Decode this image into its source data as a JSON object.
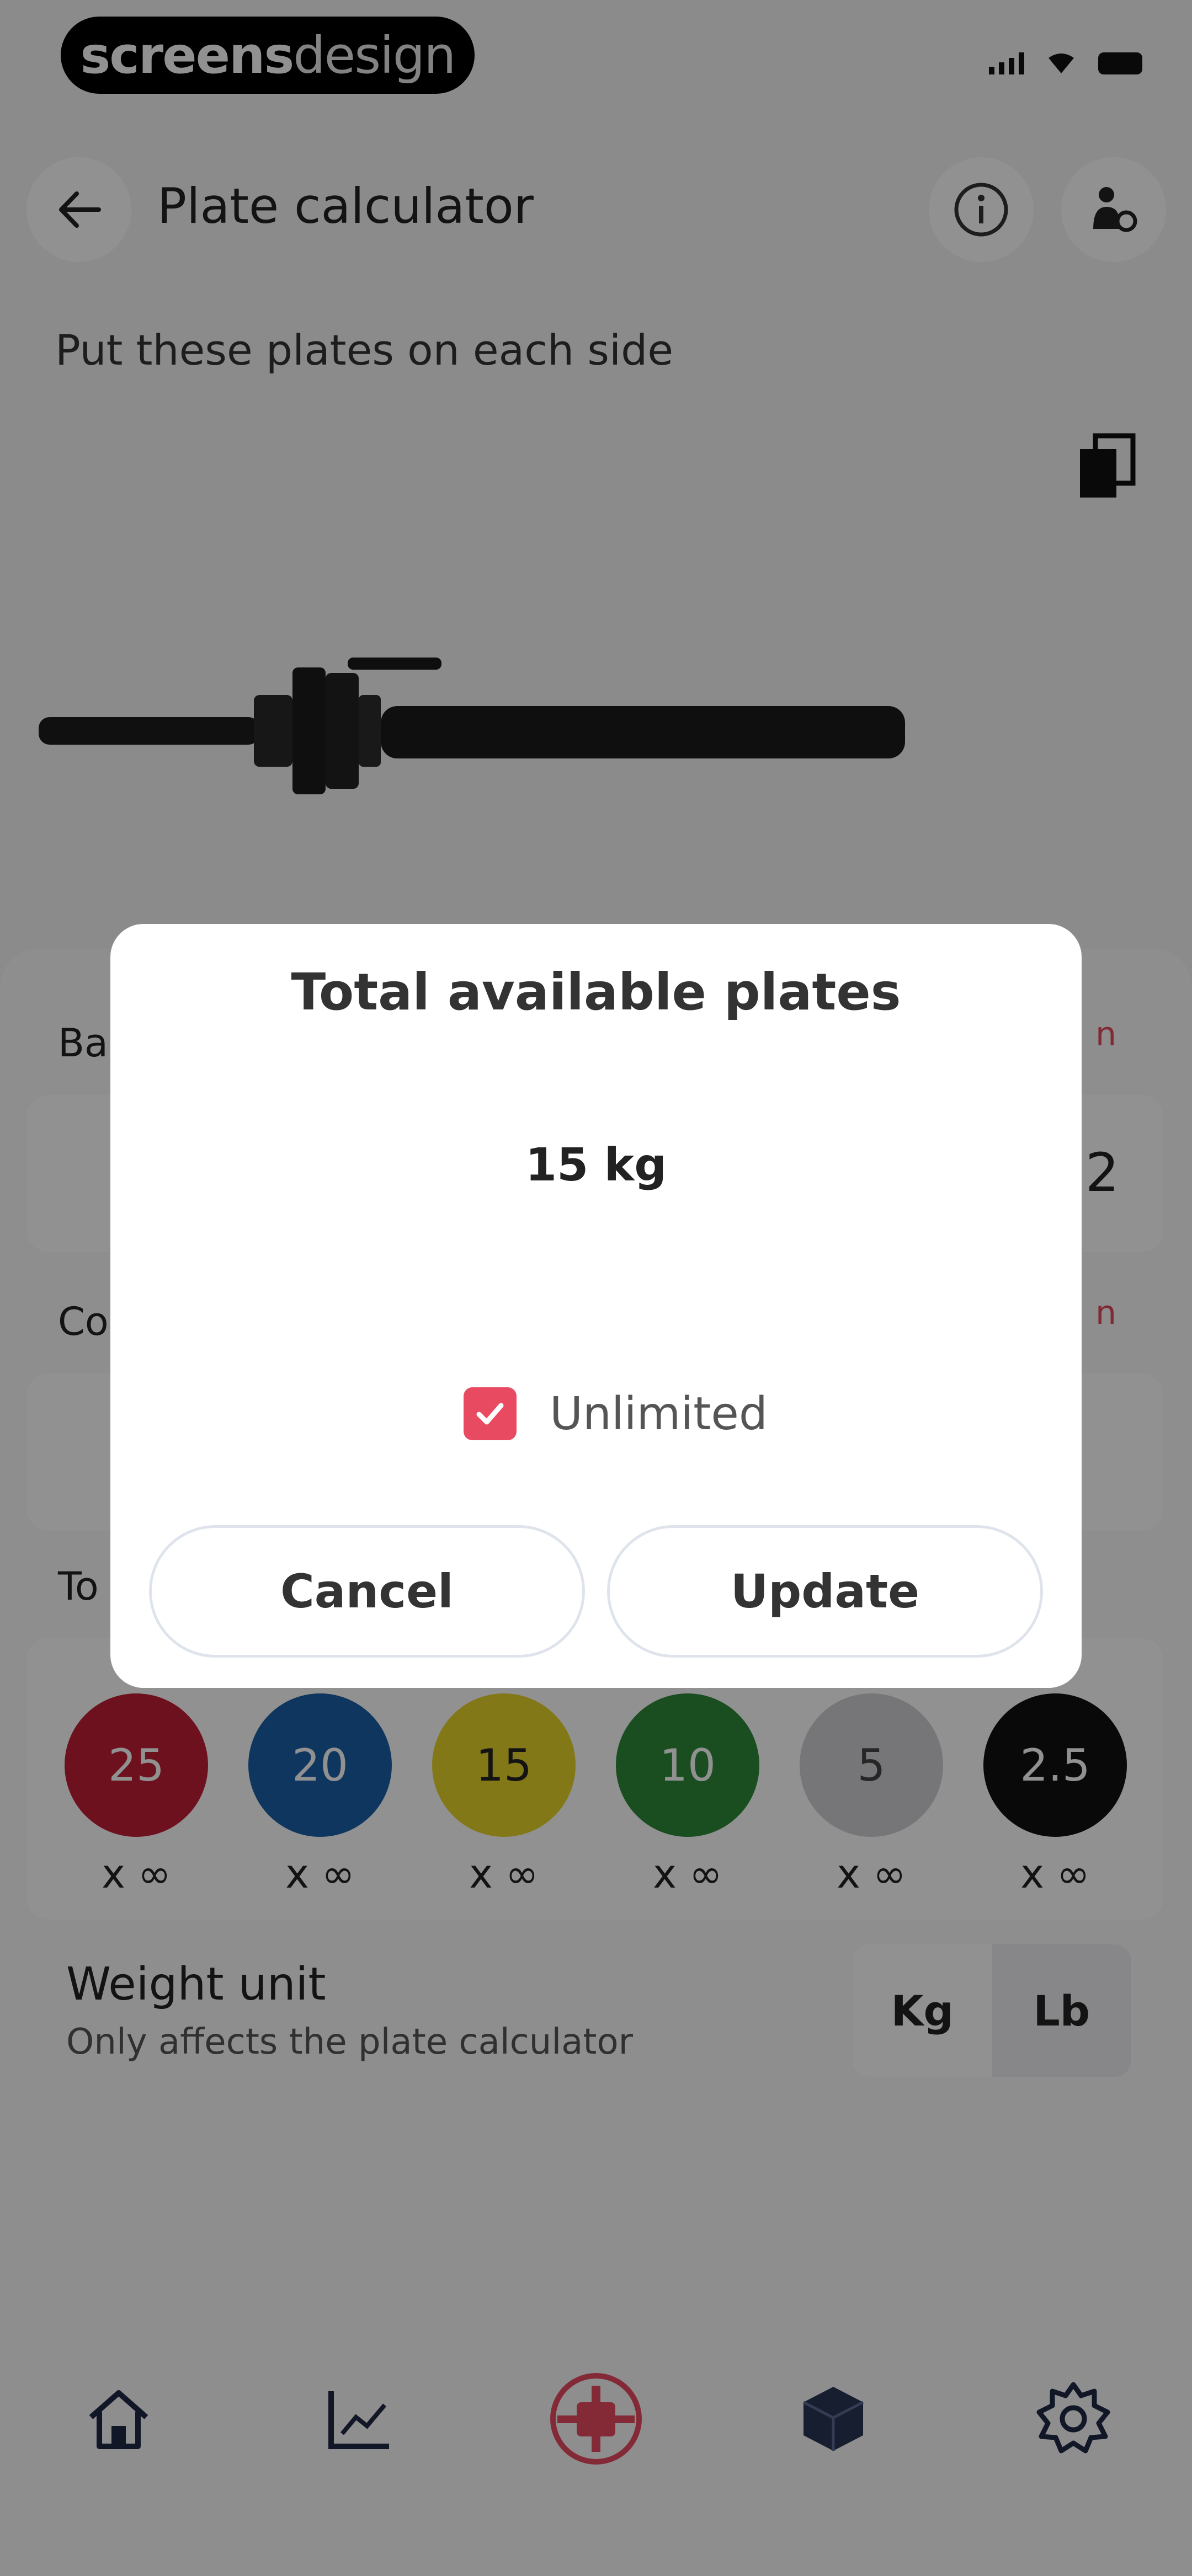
{
  "brand": {
    "bold": "screens",
    "light": "design"
  },
  "header": {
    "title": "Plate calculator"
  },
  "subtitle": "Put these plates on each side",
  "sheet": {
    "bar_label": "Ba",
    "bar_value": "2",
    "collar_label": "Co",
    "total_label": "To",
    "edit_label": "n"
  },
  "plates": [
    {
      "label": "25",
      "count": "x ∞",
      "color": "#c11e35"
    },
    {
      "label": "20",
      "count": "x ∞",
      "color": "#1a5fa5"
    },
    {
      "label": "15",
      "count": "x ∞",
      "color": "#e7d32b"
    },
    {
      "label": "10",
      "count": "x ∞",
      "color": "#2f8a3b"
    },
    {
      "label": "5",
      "count": "x ∞",
      "color": "#cfcfd4"
    },
    {
      "label": "2.5",
      "count": "x ∞",
      "color": "#111111"
    }
  ],
  "weight_unit": {
    "title": "Weight unit",
    "subtitle": "Only affects the plate calculator",
    "options": [
      "Kg",
      "Lb"
    ],
    "selected": "Kg"
  },
  "nav": [
    "home-icon",
    "chart-icon",
    "plate-icon",
    "cube-icon",
    "settings-icon"
  ],
  "dialog": {
    "title": "Total available plates",
    "value": "15 kg",
    "checkbox_label": "Unlimited",
    "checked": true,
    "cancel_label": "Cancel",
    "update_label": "Update"
  },
  "colors": {
    "accent": "#e84a62"
  }
}
